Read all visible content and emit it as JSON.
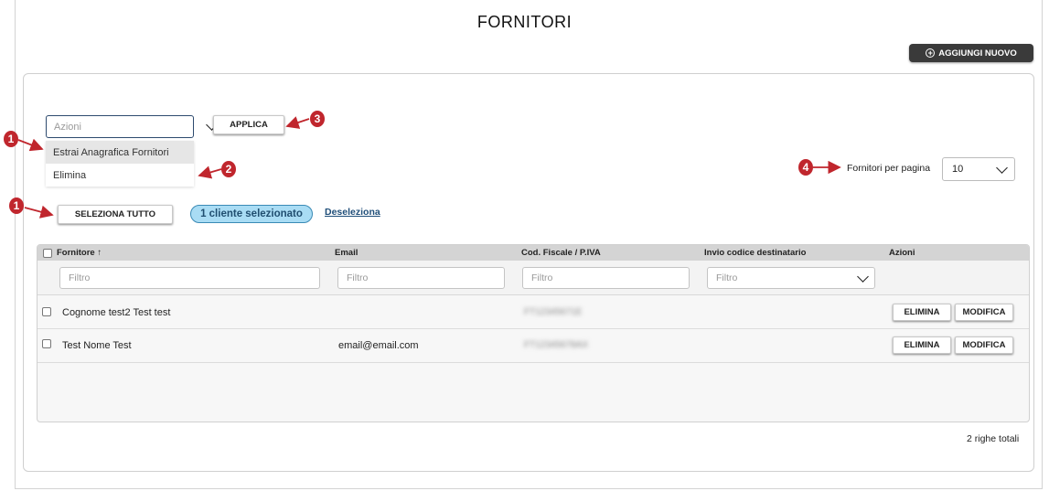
{
  "page": {
    "title": "FORNITORI"
  },
  "toolbar": {
    "add_new_label": "AGGIUNGI NUOVO"
  },
  "bulk_actions": {
    "placeholder": "Azioni",
    "options": [
      "Estrai Anagrafica Fornitori",
      "Elimina"
    ],
    "apply_label": "APPLICA",
    "select_all_label": "SELEZIONA TUTTO",
    "selected_badge": "1 cliente selezionato",
    "deselect_label": "Deseleziona"
  },
  "pagination": {
    "per_page_label": "Fornitori per pagina",
    "per_page_value": "10"
  },
  "annotations": [
    "1",
    "2",
    "3",
    "4",
    "1"
  ],
  "table": {
    "columns": [
      {
        "label": "Fornitore",
        "sort": "↑"
      },
      {
        "label": "Email"
      },
      {
        "label": "Cod. Fiscale / P.IVA"
      },
      {
        "label": "Invio codice destinatario"
      },
      {
        "label": "Azioni"
      }
    ],
    "filter_placeholder": "Filtro",
    "rows": [
      {
        "name": "Cognome test2 Test test",
        "email": "",
        "code": "FT12345671E"
      },
      {
        "name": "Test Nome Test",
        "email": "email@email.com",
        "code": "FT12345678AX"
      }
    ],
    "delete_label": "ELIMINA",
    "edit_label": "MODIFICA",
    "total_rows": "2 righe totali"
  },
  "colors": {
    "accent": "#3a3a3a",
    "badge_bg": "#a9dcf4",
    "annotation": "#c0262d",
    "link": "#1f4e79"
  }
}
